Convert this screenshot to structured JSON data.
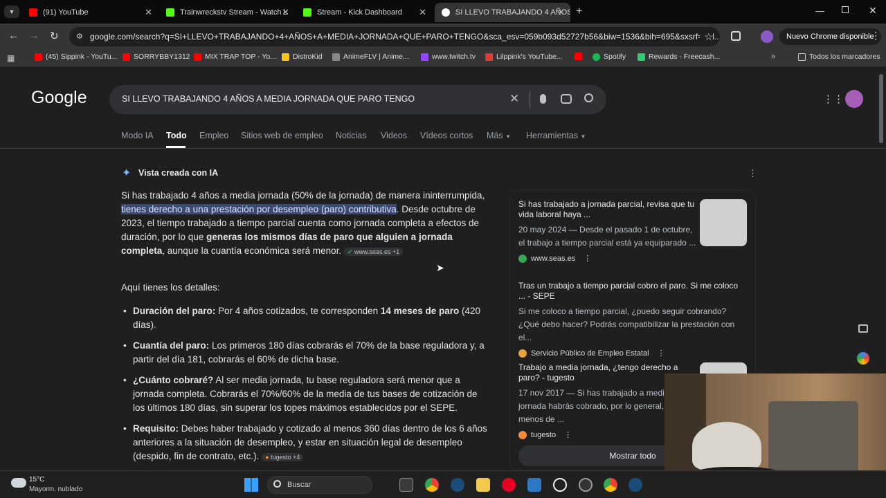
{
  "tabs": [
    {
      "title": "(91) YouTube",
      "color": "#ff0000"
    },
    {
      "title": "Trainwreckstv Stream - Watch L",
      "color": "#53fc18"
    },
    {
      "title": "Stream - Kick Dashboard",
      "color": "#53fc18"
    },
    {
      "title": "SI LLEVO TRABAJANDO 4 AÑOS",
      "color": "#4285f4"
    }
  ],
  "toolbar": {
    "url": "google.com/search?q=SI+LLEVO+TRABAJANDO+4+AÑOS+A+MEDIA+JORNADA+QUE+PARO+TENGO&sca_esv=059b093d52727b56&biw=1536&bih=695&sxsrf=AN...",
    "update_label": "Nuevo Chrome disponible"
  },
  "bookmarks": [
    {
      "label": "(45) Sippink - YouTu...",
      "color": "#ff0000"
    },
    {
      "label": "SORRYBBY1312",
      "color": "#ff0000"
    },
    {
      "label": "MIX TRAP TOP - Yo...",
      "color": "#ff0000"
    },
    {
      "label": "DistroKid",
      "color": "#f5c518"
    },
    {
      "label": "AnimeFLV | Anime...",
      "color": "#888888"
    },
    {
      "label": "www.twitch.tv",
      "color": "#9146ff"
    },
    {
      "label": "Lilppink's YouTube...",
      "color": "#e53935"
    },
    {
      "label": "",
      "color": "#ff0000"
    },
    {
      "label": "Spotify",
      "color": "#1db954"
    },
    {
      "label": "Rewards - Freecash...",
      "color": "#2ecc71"
    }
  ],
  "bookmarks_all": "Todos los marcadores",
  "google": {
    "logo": "Google",
    "query": "SI LLEVO TRABAJANDO 4 AÑOS A MEDIA JORNADA QUE PARO TENGO",
    "nav": [
      "Modo IA",
      "Todo",
      "Empleo",
      "Sitios web de empleo",
      "Noticias",
      "Videos",
      "Vídeos cortos",
      "Más",
      "Herramientas"
    ]
  },
  "ai": {
    "header": "Vista creada con IA",
    "p1_a": "Si has trabajado 4 años a media jornada (50% de la jornada) de manera ininterrumpida, ",
    "p1_hl": "tienes derecho a una prestación por desempleo (paro) contributiva",
    "p1_b": ". Desde octubre de 2023, el tiempo trabajado a tiempo parcial cuenta como jornada completa a efectos de duración, por lo que ",
    "p1_bold": "generas los mismos días de paro que alguien a jornada completa",
    "p1_c": ", aunque la cuantía económica será menor.",
    "p1_chip": "www.seas.es +1",
    "details_intro": "Aquí tienes los detalles:",
    "bullets": [
      {
        "head": "Duración del paro:",
        "text_a": " Por 4 años cotizados, te corresponden ",
        "bold": "14 meses de paro",
        "text_b": " (420 días).",
        "chip": ""
      },
      {
        "head": "Cuantía del paro:",
        "text_a": " Los primeros 180 días cobrarás el 70% de la base reguladora y, a partir del día 181, cobrarás el 60% de dicha base.",
        "bold": "",
        "text_b": "",
        "chip": ""
      },
      {
        "head": "¿Cuánto cobraré?",
        "text_a": " Al ser media jornada, tu base reguladora será menor que a jornada completa. Cobrarás el 70%/60% de la media de tus bases de cotización de los últimos 180 días, sin superar los topes máximos establecidos por el SEPE.",
        "bold": "",
        "text_b": "",
        "chip": ""
      },
      {
        "head": "Requisito:",
        "text_a": " Debes haber trabajado y cotizado al menos 360 días dentro de los 6 años anteriores a la situación de desempleo, y estar en situación legal de desempleo (despido, fin de contrato, etc.).",
        "bold": "",
        "text_b": "",
        "chip": "tugesto +4"
      }
    ]
  },
  "sources": [
    {
      "title": "Si has trabajado a jornada parcial, revisa que tu vida laboral haya ...",
      "snippet": "20 may 2024 — Desde el pasado 1 de octubre, el trabajo a tiempo parcial está ya equiparado ...",
      "site": "www.seas.es",
      "color": "#34a853"
    },
    {
      "title": "Tras un trabajo a tiempo parcial cobro el paro. Si me coloco ... - SEPE",
      "snippet": "Si me coloco a tiempo parcial, ¿puedo seguir cobrando? ¿Qué debo hacer? Podrás compatibilizar la prestación con el...",
      "site": "Servicio Público de Empleo Estatal",
      "color": "#e8a33d"
    },
    {
      "title": "Trabajo a media jornada, ¿tengo derecho a paro? - tugesto",
      "snippet": "17 nov 2017 — Si has trabajado a media jornada habrás cobrado, por lo general, menos de ...",
      "site": "tugesto",
      "color": "#f28b3c"
    }
  ],
  "show_all": "Mostrar todo",
  "taskbar": {
    "temp": "15°C",
    "weather": "Mayorm. nublado",
    "search": "Buscar"
  }
}
